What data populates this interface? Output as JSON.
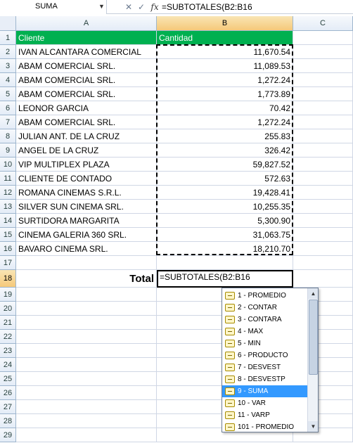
{
  "formula_bar": {
    "name_box": "SUMA",
    "formula": "=SUBTOTALES(B2:B16",
    "fx_label": "fx"
  },
  "columns": [
    "A",
    "B",
    "C"
  ],
  "header_row": {
    "row": "1",
    "a": "Cliente",
    "b": "Cantidad"
  },
  "rows": [
    {
      "row": "2",
      "a": "IVAN ALCANTARA COMERCIAL",
      "b": "11,670.54"
    },
    {
      "row": "3",
      "a": "ABAM COMERCIAL  SRL.",
      "b": "11,089.53"
    },
    {
      "row": "4",
      "a": "ABAM COMERCIAL  SRL.",
      "b": "1,272.24"
    },
    {
      "row": "5",
      "a": "ABAM COMERCIAL  SRL.",
      "b": "1,773.89"
    },
    {
      "row": "6",
      "a": "LEONOR GARCIA",
      "b": "70.42"
    },
    {
      "row": "7",
      "a": "ABAM COMERCIAL  SRL.",
      "b": "1,272.24"
    },
    {
      "row": "8",
      "a": "JULIAN ANT. DE LA CRUZ",
      "b": "255.83"
    },
    {
      "row": "9",
      "a": "ANGEL DE LA CRUZ",
      "b": "326.42"
    },
    {
      "row": "10",
      "a": "VIP MULTIPLEX PLAZA",
      "b": "59,827.52"
    },
    {
      "row": "11",
      "a": "CLIENTE DE CONTADO",
      "b": "572.63"
    },
    {
      "row": "12",
      "a": "ROMANA CINEMAS S.R.L.",
      "b": "19,428.41"
    },
    {
      "row": "13",
      "a": "SILVER SUN CINEMA SRL.",
      "b": "10,255.35"
    },
    {
      "row": "14",
      "a": "SURTIDORA MARGARITA",
      "b": "5,300.90"
    },
    {
      "row": "15",
      "a": "CINEMA GALERIA 360  SRL.",
      "b": "31,063.75"
    },
    {
      "row": "16",
      "a": "BAVARO CINEMA SRL.",
      "b": "18,210.70"
    }
  ],
  "empty_rows": [
    "17",
    "19",
    "20",
    "21",
    "22",
    "23",
    "24",
    "25",
    "26",
    "27",
    "28",
    "29"
  ],
  "total_row": {
    "row": "18",
    "label": "Total",
    "input": "=SUBTOTALES(B2:B16"
  },
  "autocomplete": {
    "items": [
      "1 - PROMEDIO",
      "2 - CONTAR",
      "3 - CONTARA",
      "4 - MAX",
      "5 - MIN",
      "6 - PRODUCTO",
      "7 - DESVEST",
      "8 - DESVESTP",
      "9 - SUMA",
      "10 - VAR",
      "11 - VARP",
      "101 - PROMEDIO"
    ],
    "selected_index": 8,
    "scroll_position": 0
  },
  "colors": {
    "header_fill": "#00b050",
    "selection_highlight": "#3399ff",
    "active_header": "#f5c97a"
  },
  "icons": {
    "name_box_dropdown": "chevron-down-icon",
    "cancel": "close-icon",
    "enter": "checkmark-icon",
    "insert_function": "fx-icon",
    "list_item": "function-icon"
  }
}
